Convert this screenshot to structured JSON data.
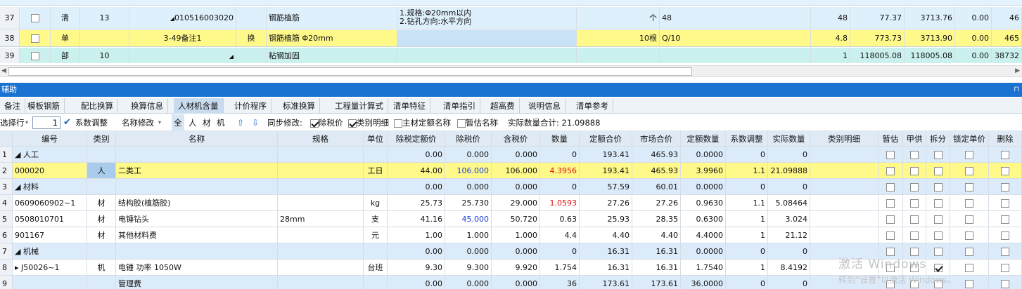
{
  "top_rows": [
    {
      "num": "37",
      "seq": "13",
      "type": "清",
      "expand": "◢",
      "code": "010516003020",
      "swap": "",
      "name": "钢筋植筋",
      "spec": [
        "1.规格:Φ20mm以内",
        "2.钻孔方向:水平方向"
      ],
      "unit": "个",
      "expr": "48",
      "qty": "48",
      "price": "77.37",
      "total": "3713.76",
      "rate": "0.00",
      "extra": "46"
    },
    {
      "num": "38",
      "seq": "",
      "type": "单",
      "expand": "",
      "code": "3-49备注1",
      "swap": "换",
      "name": "钢筋植筋 Φ20mm",
      "spec": [],
      "unit": "10根",
      "expr": "Q/10",
      "qty": "4.8",
      "price": "773.73",
      "total": "3713.90",
      "rate": "0.00",
      "extra": "465"
    },
    {
      "num": "39",
      "seq": "10",
      "type": "部",
      "expand": "◢",
      "code": "",
      "swap": "",
      "name": "粘钢加固",
      "spec": [],
      "unit": "",
      "expr": "",
      "qty": "1",
      "price": "118005.08",
      "total": "118005.08",
      "rate": "0.00",
      "extra": "38732"
    }
  ],
  "panel_title": "辅助",
  "panel_pin": "⊓",
  "tabs": [
    "备注",
    "模板钢筋",
    "配比换算",
    "换算信息",
    "人材机含量",
    "计价程序",
    "标准换算",
    "工程量计算式",
    "清单特征",
    "清单指引",
    "超高费",
    "说明信息",
    "清单参考"
  ],
  "active_tab": 4,
  "toolbar": {
    "select_rows": "选择行",
    "row_count": "1",
    "coef_adjust": "系数调整",
    "name_modify": "名称修改",
    "filters": [
      "全",
      "人",
      "材",
      "机"
    ],
    "sync_modify": "同步修改:",
    "chk_excl_tax": "除税价",
    "chk_category": "类别明细",
    "chk_main_name": "主材定额名称",
    "chk_provisional": "暂估名称",
    "actual_total_label": "实际数量合计: 21.09888"
  },
  "columns": [
    "编号",
    "类别",
    "名称",
    "规格",
    "单位",
    "除税定额价",
    "除税价",
    "含税价",
    "数量",
    "定额合价",
    "市场合价",
    "定额数量",
    "系数调整",
    "实际数量",
    "类别明细",
    "暂估",
    "甲供",
    "拆分",
    "锁定单价",
    "删除"
  ],
  "rows": [
    {
      "n": "1",
      "code": "◢ 人工",
      "cat": "",
      "name": "",
      "spec": "",
      "unit": "",
      "p1": "0.00",
      "p2": "0.000",
      "p3": "0.000",
      "qty": "0",
      "t1": "193.41",
      "t2": "465.93",
      "dq": "0.0000",
      "coef": "0",
      "aq": "0",
      "group": true,
      "chk": [
        false,
        false,
        false,
        false,
        false
      ]
    },
    {
      "n": "2",
      "code": "000020",
      "cat": "人",
      "name": "二类工",
      "spec": "",
      "unit": "工日",
      "p1": "44.00",
      "p2": "106.000",
      "p3": "106.000",
      "qty": "4.3956",
      "t1": "193.41",
      "t2": "465.93",
      "dq": "3.9960",
      "coef": "1.1",
      "aq": "21.09888",
      "sel": true,
      "p2c": "blue",
      "qtyc": "red",
      "chk": [
        false,
        false,
        false,
        false,
        false
      ]
    },
    {
      "n": "3",
      "code": "◢ 材料",
      "cat": "",
      "name": "",
      "spec": "",
      "unit": "",
      "p1": "0.00",
      "p2": "0.000",
      "p3": "0.000",
      "qty": "0",
      "t1": "57.59",
      "t2": "60.01",
      "dq": "0.0000",
      "coef": "0",
      "aq": "0",
      "group": true,
      "chk": [
        false,
        false,
        false,
        false,
        false
      ]
    },
    {
      "n": "4",
      "code": "0609060902~1",
      "cat": "材",
      "name": "结构胶(植筋胶)",
      "spec": "",
      "unit": "kg",
      "p1": "25.73",
      "p2": "25.730",
      "p3": "29.000",
      "qty": "1.0593",
      "t1": "27.26",
      "t2": "27.26",
      "dq": "0.9630",
      "coef": "1.1",
      "aq": "5.08464",
      "qtyc": "red",
      "chk": [
        false,
        false,
        false,
        false,
        false
      ]
    },
    {
      "n": "5",
      "code": "0508010701",
      "cat": "材",
      "name": "电锤钻头",
      "spec": "28mm",
      "unit": "支",
      "p1": "41.16",
      "p2": "45.000",
      "p3": "50.720",
      "qty": "0.63",
      "t1": "25.93",
      "t2": "28.35",
      "dq": "0.6300",
      "coef": "1",
      "aq": "3.024",
      "p2c": "blue",
      "chk": [
        false,
        false,
        false,
        false,
        false
      ]
    },
    {
      "n": "6",
      "code": "901167",
      "cat": "材",
      "name": "其他材料费",
      "spec": "",
      "unit": "元",
      "p1": "1.00",
      "p2": "1.000",
      "p3": "1.000",
      "qty": "4.4",
      "t1": "4.40",
      "t2": "4.40",
      "dq": "4.4000",
      "coef": "1",
      "aq": "21.12",
      "chk": [
        false,
        false,
        false,
        false,
        false
      ]
    },
    {
      "n": "7",
      "code": "◢ 机械",
      "cat": "",
      "name": "",
      "spec": "",
      "unit": "",
      "p1": "0.00",
      "p2": "0.000",
      "p3": "0.000",
      "qty": "0",
      "t1": "16.31",
      "t2": "16.31",
      "dq": "0.0000",
      "coef": "0",
      "aq": "0",
      "group": true,
      "chk": [
        false,
        false,
        false,
        false,
        false
      ]
    },
    {
      "n": "8",
      "code": "▸ J50026~1",
      "cat": "机",
      "name": "电锤 功率 1050W",
      "spec": "",
      "unit": "台班",
      "p1": "9.30",
      "p2": "9.300",
      "p3": "9.920",
      "qty": "1.754",
      "t1": "16.31",
      "t2": "16.31",
      "dq": "1.7540",
      "coef": "1",
      "aq": "8.4192",
      "chk": [
        false,
        false,
        true,
        false,
        false
      ]
    },
    {
      "n": "9",
      "code": "",
      "cat": "",
      "name": "管理费",
      "spec": "",
      "unit": "",
      "p1": "0.00",
      "p2": "0.000",
      "p3": "0.000",
      "qty": "36",
      "t1": "173.61",
      "t2": "173.61",
      "dq": "36.0000",
      "coef": "0",
      "aq": "0",
      "group": true,
      "chk": [
        false,
        false,
        false,
        false,
        false
      ]
    }
  ],
  "watermark": "激活 Windows",
  "watermark_sub": "转到“设置”以激活 Windows。"
}
